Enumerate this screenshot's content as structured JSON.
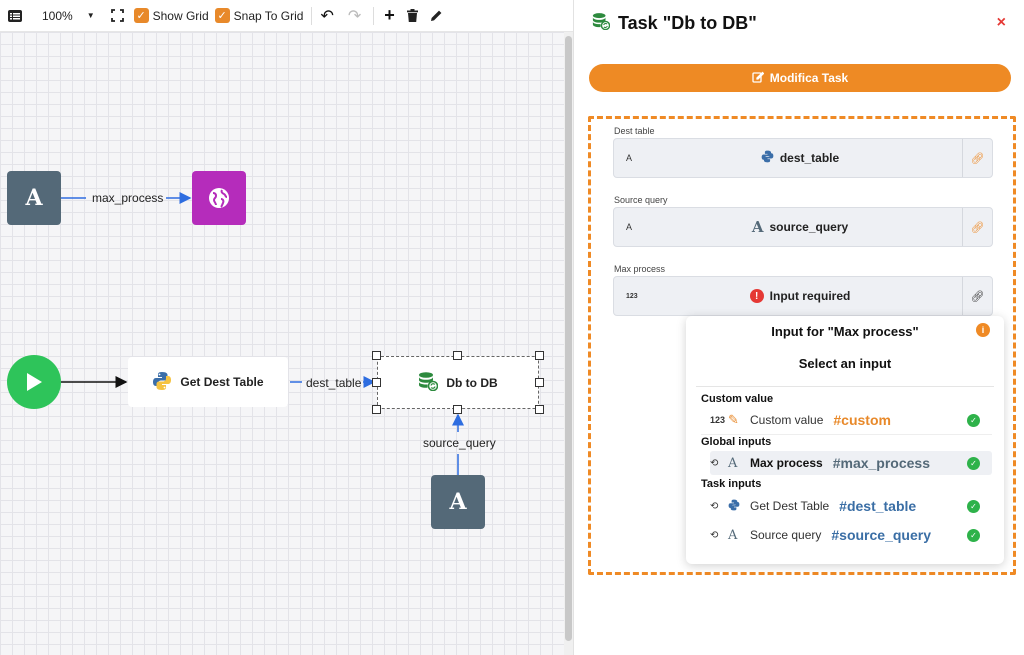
{
  "toolbar": {
    "zoom": "100%",
    "show_grid_label": "Show Grid",
    "snap_to_grid_label": "Snap To Grid",
    "show_grid_checked": true,
    "snap_to_grid_checked": true
  },
  "canvas": {
    "nodes": {
      "input_a_top": "A",
      "input_a_bottom": "A",
      "get_dest_table": "Get Dest Table",
      "db_to_db": "Db to DB"
    },
    "edges": {
      "max_process": "max_process",
      "dest_table": "dest_table",
      "source_query": "source_query"
    }
  },
  "panel": {
    "title": "Task \"Db to DB\"",
    "close_label": "×",
    "edit_button_label": "Modifica Task",
    "fields": [
      {
        "label": "Dest table",
        "type": "A",
        "value": "dest_table",
        "icon": "python-icon"
      },
      {
        "label": "Source query",
        "type": "A",
        "value": "source_query",
        "icon": "text-a-icon"
      },
      {
        "label": "Max process",
        "type": "123",
        "value": "Input required",
        "icon": "error-icon"
      }
    ],
    "popup": {
      "title": "Input for \"Max process\"",
      "subtitle": "Select an input",
      "groups": {
        "custom": "Custom value",
        "global": "Global inputs",
        "task": "Task inputs"
      },
      "options": {
        "custom": {
          "type": "123",
          "label": "Custom value",
          "tag": "#custom"
        },
        "global": {
          "label": "Max process",
          "tag": "#max_process"
        },
        "task1": {
          "label": "Get Dest Table",
          "tag": "#dest_table"
        },
        "task2": {
          "label": "Source query",
          "tag": "#source_query"
        }
      }
    }
  },
  "colors": {
    "accent": "#ee8a24",
    "node_input": "#546978",
    "node_globe": "#b52cbb",
    "node_start": "#2ec45a",
    "link_blue": "#3a6ea5",
    "success": "#2eb24a",
    "error": "#e53935"
  }
}
